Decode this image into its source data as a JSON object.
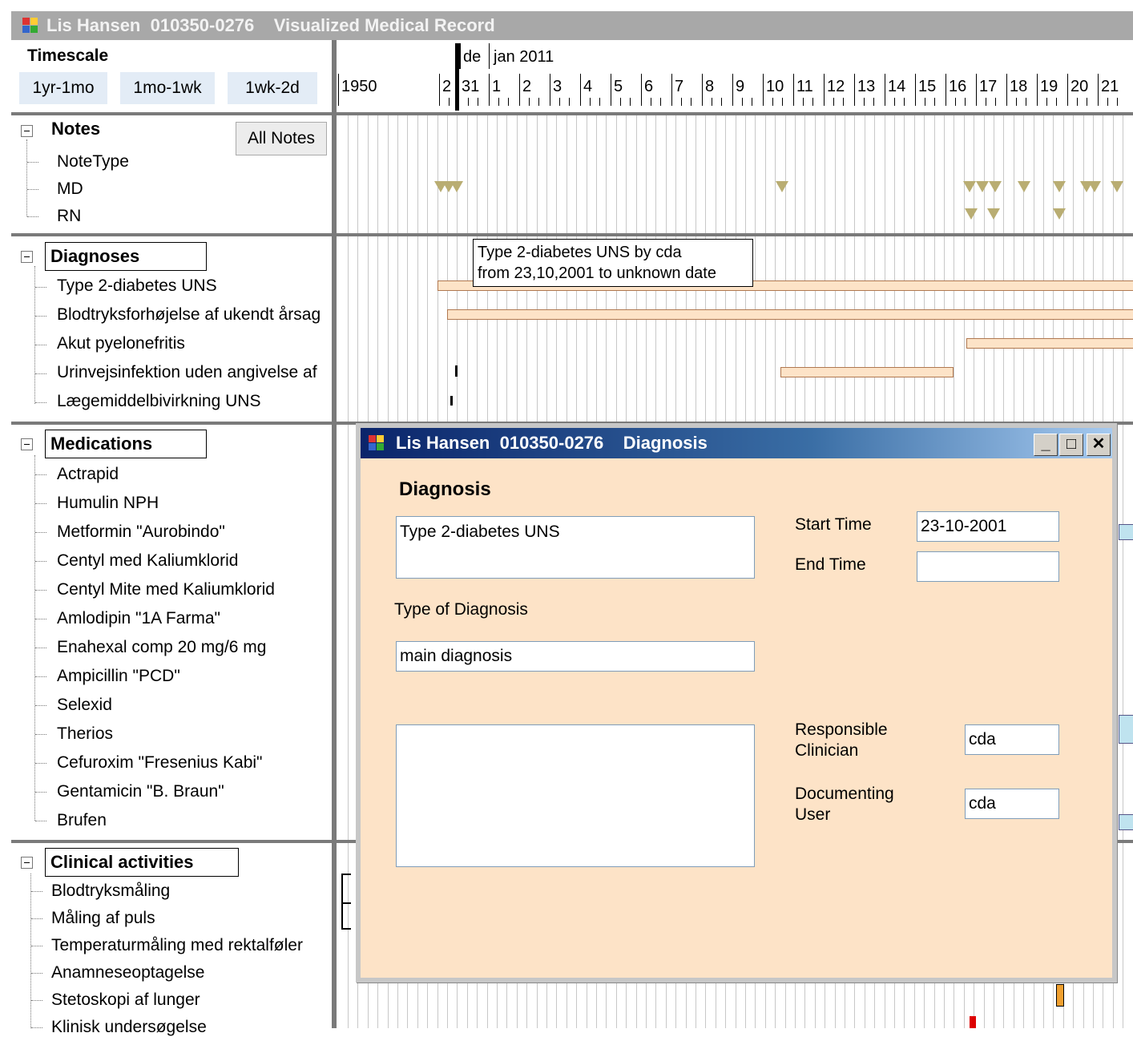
{
  "main_window": {
    "title": "Lis Hansen  010350-0276    Visualized Medical Record"
  },
  "timescale": {
    "label": "Timescale",
    "buttons": [
      "1yr-1mo",
      "1mo-1wk",
      "1wk-2d"
    ]
  },
  "timeline_header": {
    "month_labels": [
      "de",
      "jan 2011"
    ],
    "year_label": "1950",
    "day_labels": [
      "2",
      "31",
      "1",
      "2",
      "3",
      "4",
      "5",
      "6",
      "7",
      "8",
      "9",
      "10",
      "11",
      "12",
      "13",
      "14",
      "15",
      "16",
      "17",
      "18",
      "19",
      "20",
      "21"
    ]
  },
  "notes": {
    "title": "Notes",
    "all_notes_button": "All Notes",
    "items": [
      "NoteType",
      "MD",
      "RN"
    ]
  },
  "diagnoses": {
    "title": "Diagnoses",
    "items": [
      "Type 2-diabetes UNS",
      "Blodtryksforhøjelse af ukendt årsag",
      "Akut pyelonefritis",
      "Urinvejsinfektion uden angivelse af",
      "Lægemiddelbivirkning UNS"
    ],
    "tooltip_line1": "Type 2-diabetes UNS by cda",
    "tooltip_line2": "from 23,10,2001 to unknown date"
  },
  "medications": {
    "title": "Medications",
    "items": [
      "Actrapid",
      "Humulin NPH",
      "Metformin \"Aurobindo\"",
      "Centyl med Kaliumklorid",
      "Centyl Mite med Kaliumklorid",
      "Amlodipin \"1A Farma\"",
      "Enahexal comp 20 mg/6 mg",
      "Ampicillin \"PCD\"",
      "Selexid",
      "Therios",
      "Cefuroxim \"Fresenius Kabi\"",
      "Gentamicin \"B. Braun\"",
      "Brufen"
    ]
  },
  "clinical_activities": {
    "title": "Clinical activities",
    "items": [
      "Blodtryksmåling",
      "Måling af puls",
      "Temperaturmåling med rektalføler",
      "Anamneseoptagelse",
      "Stetoskopi af lunger",
      "Klinisk undersøgelse"
    ]
  },
  "dialog": {
    "title": "Lis Hansen  010350-0276    Diagnosis",
    "heading": "Diagnosis",
    "diagnosis_value": "Type 2-diabetes UNS",
    "start_time_label": "Start Time",
    "start_time_value": "23-10-2001",
    "end_time_label": "End Time",
    "end_time_value": "",
    "type_label": "Type of Diagnosis",
    "type_value": "main diagnosis",
    "responsible_label_1": "Responsible",
    "responsible_label_2": "Clinician",
    "responsible_value": "cda",
    "documenting_label_1": "Documenting",
    "documenting_label_2": "User",
    "documenting_value": "cda",
    "minimize": "_",
    "maximize": "□",
    "close": "✕"
  },
  "colors": {
    "diagnosis_bar": "#fde3c7",
    "note_marker": "#b9ad72",
    "dialog_bg": "#fde3c7",
    "title_active": "#0a246a",
    "title_inactive": "#a8a8a8"
  }
}
